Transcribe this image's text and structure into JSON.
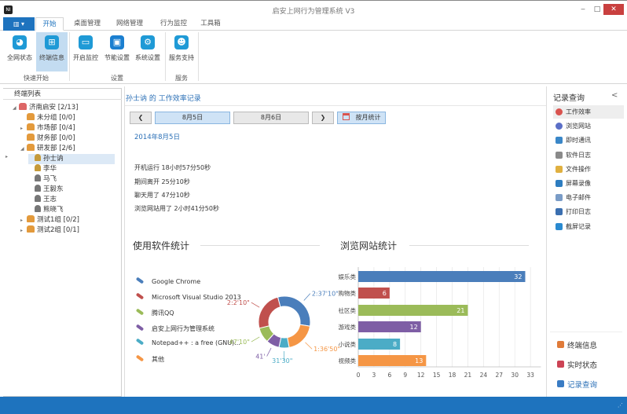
{
  "window": {
    "title": "启安上网行为管理系统 V3",
    "app_icon": "NI",
    "minimize": "‒",
    "maximize": "□",
    "close": "✕"
  },
  "menu": {
    "file_button": "▥ ▾",
    "tabs": [
      "开始",
      "桌面管理",
      "网络管理",
      "行为监控",
      "工具箱"
    ]
  },
  "ribbon": {
    "buttons": [
      {
        "label": "全网状态",
        "icon": "globe-icon"
      },
      {
        "label": "终端信息",
        "icon": "windows-icon"
      },
      {
        "label": "开启监控",
        "icon": "monitor-icon"
      },
      {
        "label": "节能设置",
        "icon": "power-icon"
      },
      {
        "label": "系统设置",
        "icon": "gear-icon"
      },
      {
        "label": "服务支持",
        "icon": "users-icon"
      }
    ],
    "groups": [
      "快速开始",
      "设置",
      "服务"
    ]
  },
  "tree": {
    "header": "终端列表",
    "nodes": [
      {
        "label": "济南启安  [2/13]",
        "type": "root"
      },
      {
        "label": "未分组  [0/0]",
        "type": "group"
      },
      {
        "label": "市场部  [0/4]",
        "type": "group"
      },
      {
        "label": "财务部  [0/0]",
        "type": "group"
      },
      {
        "label": "研发部  [2/6]",
        "type": "group"
      },
      {
        "label": "孙士讷",
        "type": "user-online"
      },
      {
        "label": "李华",
        "type": "user-online"
      },
      {
        "label": "马飞",
        "type": "user"
      },
      {
        "label": "王毅东",
        "type": "user"
      },
      {
        "label": "王志",
        "type": "user"
      },
      {
        "label": "熊晓飞",
        "type": "user"
      },
      {
        "label": "测试1组  [0/2]",
        "type": "group"
      },
      {
        "label": "测试2组  [0/1]",
        "type": "group"
      }
    ]
  },
  "main": {
    "title": "孙士讷 的 工作效率记录",
    "prev": "❮",
    "next": "❯",
    "day1": "8月5日",
    "day2": "8月6日",
    "month_button": "按月统计",
    "date": "2014年8月5日",
    "stats": [
      "开机运行 18小时57分50秒",
      "期间离开 25分10秒",
      "聊天用了 47分10秒",
      "浏览网站用了 2小时41分50秒"
    ],
    "software_title": "使用软件统计",
    "web_title": "浏览网站统计"
  },
  "chart_data": [
    {
      "type": "pie",
      "title": "使用软件统计",
      "donut": true,
      "labels": [
        "Google Chrome",
        "Microsoft Visual Studio 2013",
        "腾讯QQ",
        "启安上网行为管理系统",
        "Notepad++ : a free (GNU)...",
        "其他"
      ],
      "value_labels": [
        "2:37'10\"",
        "2:2'10\"",
        "47'10\"",
        "41'",
        "31'30\"",
        "1:36'50\""
      ],
      "values_seconds": [
        9430,
        7330,
        2830,
        2460,
        1890,
        5810
      ],
      "colors": [
        "#4a7ebb",
        "#c0504d",
        "#9bbb59",
        "#7e5ea5",
        "#4bacc6",
        "#f59645"
      ],
      "clockwise_order": [
        0,
        5,
        4,
        3,
        2,
        1
      ],
      "legend": "left"
    },
    {
      "type": "bar",
      "orientation": "horizontal",
      "title": "浏览网站统计",
      "categories": [
        "娱乐类",
        "购物类",
        "社区类",
        "游戏类",
        "小说类",
        "视频类"
      ],
      "values": [
        32,
        6,
        21,
        12,
        8,
        13
      ],
      "colors": [
        "#4a7ebb",
        "#c0504d",
        "#9bbb59",
        "#7e5ea5",
        "#4bacc6",
        "#f59645"
      ],
      "xlim": [
        0,
        35
      ],
      "xticks": [
        0,
        3,
        6,
        9,
        12,
        15,
        18,
        21,
        24,
        27,
        30,
        33
      ],
      "grid": true
    }
  ],
  "right": {
    "title": "记录查询",
    "collapse": "<",
    "items": [
      {
        "label": "工作效率",
        "color": "#d9534f"
      },
      {
        "label": "浏览网站",
        "color": "#5b6fc7"
      },
      {
        "label": "即时通讯",
        "color": "#3a87c8"
      },
      {
        "label": "软件日志",
        "color": "#8a8a8a"
      },
      {
        "label": "文件操作",
        "color": "#e0b040"
      },
      {
        "label": "屏幕录像",
        "color": "#2d7dc0"
      },
      {
        "label": "电子邮件",
        "color": "#7a9cc7"
      },
      {
        "label": "打印日志",
        "color": "#3b6fb0"
      },
      {
        "label": "截屏记录",
        "color": "#2a8ad0"
      }
    ],
    "bottom": [
      {
        "label": "终端信息",
        "icon": "windows-icon"
      },
      {
        "label": "实时状态",
        "icon": "clock-icon"
      },
      {
        "label": "记录查询",
        "icon": "search-icon"
      }
    ]
  }
}
